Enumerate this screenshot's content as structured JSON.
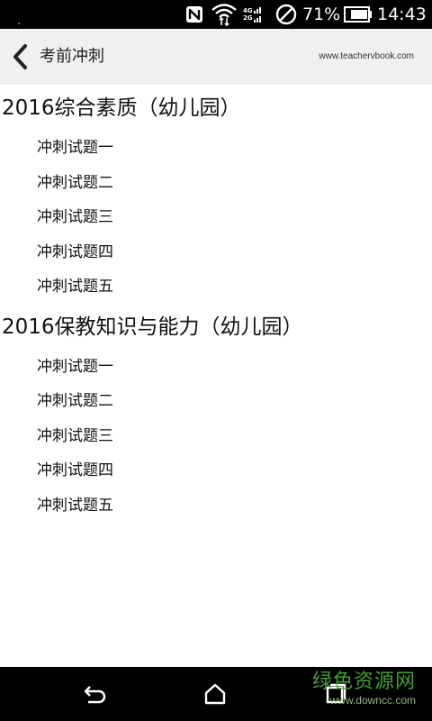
{
  "status_bar": {
    "net_top": "4G",
    "net_bottom": "2G",
    "battery_percent": "71%",
    "time": "14:43",
    "icons": [
      "nfc-icon",
      "wifi-icon",
      "signal-icon",
      "do-not-disturb-icon",
      "battery-icon"
    ]
  },
  "app_bar": {
    "title": "考前冲刺",
    "url": "www.teachervbook.com",
    "back_icon": "chevron-left-icon"
  },
  "sections": [
    {
      "title": "2016综合素质（幼儿园）",
      "items": [
        "冲刺试题一",
        "冲刺试题二",
        "冲刺试题三",
        "冲刺试题四",
        "冲刺试题五"
      ]
    },
    {
      "title": "2016保教知识与能力（幼儿园）",
      "items": [
        "冲刺试题一",
        "冲刺试题二",
        "冲刺试题三",
        "冲刺试题四",
        "冲刺试题五"
      ]
    }
  ],
  "nav_bar": {
    "icons": [
      "back-arrow-icon",
      "home-icon",
      "recent-apps-icon"
    ]
  },
  "watermark": {
    "main": "绿色资源网",
    "sub": "www.downcc.com"
  },
  "colors": {
    "status_bar_bg": "#000000",
    "app_bar_bg": "#f0f0f0",
    "content_bg": "#ffffff",
    "watermark_green": "#4caf3a"
  }
}
